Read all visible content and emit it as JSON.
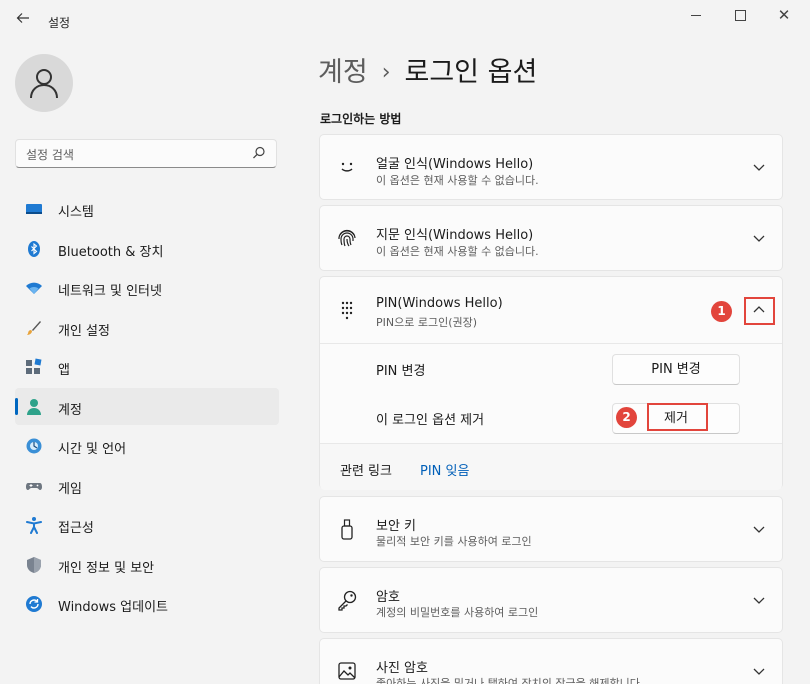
{
  "window": {
    "app_title": "설정",
    "back_icon": "back-arrow-icon",
    "close_glyph": "✕"
  },
  "sidebar": {
    "search_placeholder": "설정 검색",
    "items": [
      {
        "label": "시스템",
        "icon": "system-icon",
        "active": false
      },
      {
        "label": "Bluetooth & 장치",
        "icon": "bluetooth-icon",
        "active": false
      },
      {
        "label": "네트워크 및 인터넷",
        "icon": "wifi-icon",
        "active": false
      },
      {
        "label": "개인 설정",
        "icon": "brush-icon",
        "active": false
      },
      {
        "label": "앱",
        "icon": "apps-icon",
        "active": false
      },
      {
        "label": "계정",
        "icon": "account-icon",
        "active": true
      },
      {
        "label": "시간 및 언어",
        "icon": "globe-icon",
        "active": false
      },
      {
        "label": "게임",
        "icon": "gamepad-icon",
        "active": false
      },
      {
        "label": "접근성",
        "icon": "accessibility-icon",
        "active": false
      },
      {
        "label": "개인 정보 및 보안",
        "icon": "shield-icon",
        "active": false
      },
      {
        "label": "Windows 업데이트",
        "icon": "update-icon",
        "active": false
      }
    ]
  },
  "breadcrumb": {
    "parent": "계정",
    "separator": "›",
    "current": "로그인 옵션"
  },
  "main": {
    "section_title": "로그인하는 방법",
    "options": [
      {
        "title": "얼굴 인식(Windows Hello)",
        "subtitle": "이 옵션은 현재 사용할 수 없습니다.",
        "icon": "face-icon"
      },
      {
        "title": "지문 인식(Windows Hello)",
        "subtitle": "이 옵션은 현재 사용할 수 없습니다.",
        "icon": "fingerprint-icon"
      }
    ],
    "pin": {
      "title": "PIN(Windows Hello)",
      "subtitle": "PIN으로 로그인(권장)",
      "icon": "pin-keypad-icon",
      "expanded": true,
      "change_label": "PIN 변경",
      "change_button": "PIN 변경",
      "remove_label": "이 로그인 옵션 제거",
      "remove_button": "제거",
      "related_label": "관련 링크",
      "related_link": "PIN 잊음"
    },
    "more_options": [
      {
        "title": "보안 키",
        "subtitle": "물리적 보안 키를 사용하여 로그인",
        "icon": "security-key-icon"
      },
      {
        "title": "암호",
        "subtitle": "계정의 비밀번호를 사용하여 로그인",
        "icon": "key-icon"
      },
      {
        "title": "사진 암호",
        "subtitle": "좋아하는 사진을 밀거나 탭하여 장치의 잠금을 해제합니다",
        "icon": "picture-icon"
      }
    ]
  },
  "annotations": {
    "badge_1": "1",
    "badge_2": "2",
    "color": "#e2453c"
  },
  "colors": {
    "accent": "#0067c0",
    "link": "#005fb8",
    "background": "#f3f3f3",
    "card": "#fbfbfb"
  }
}
